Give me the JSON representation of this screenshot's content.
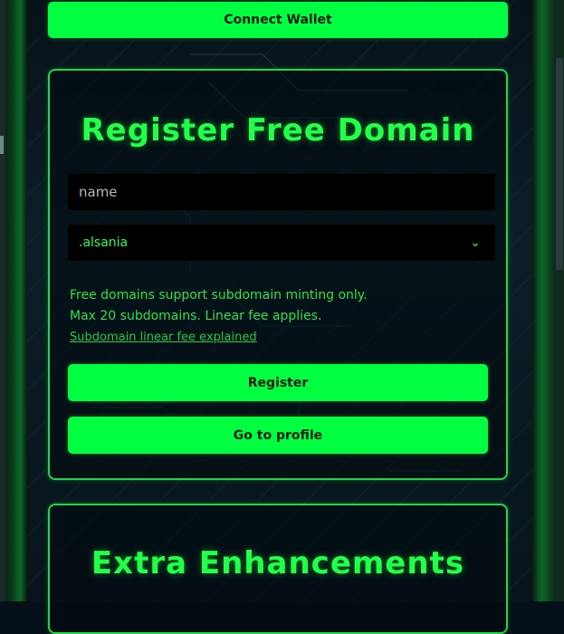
{
  "header": {
    "connect_wallet_label": "Connect Wallet"
  },
  "register_card": {
    "title": "Register Free Domain",
    "name_placeholder": "name",
    "name_value": "",
    "tld_selected": ".alsania",
    "info_line_1": "Free domains support subdomain minting only.",
    "info_line_2": "Max 20 subdomains. Linear fee applies.",
    "fee_link": "Subdomain linear fee explained",
    "register_label": "Register",
    "profile_label": "Go to profile"
  },
  "extra_card": {
    "title": "Extra Enhancements"
  },
  "icons": {
    "select_chevron": "chevron-down-icon"
  },
  "colors": {
    "accent": "#00ff41",
    "background": "#061018"
  }
}
